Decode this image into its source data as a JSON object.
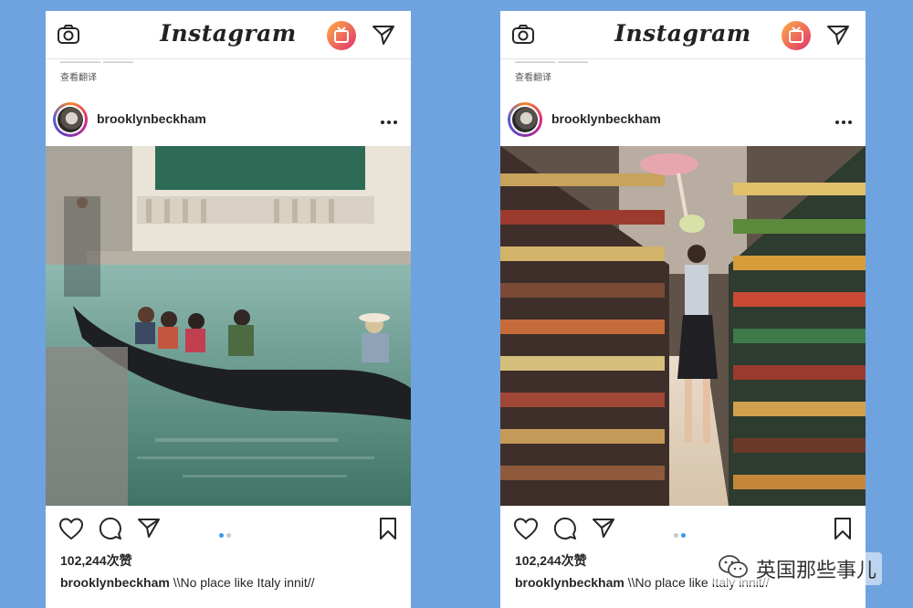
{
  "app": {
    "wordmark": "Instagram"
  },
  "icons": [
    "camera-icon",
    "igtv-icon",
    "send-icon",
    "more-icon",
    "heart-icon",
    "comment-icon",
    "share-icon",
    "bookmark-icon"
  ],
  "colors": {
    "igtv_gradient_start": "#fcaf45",
    "igtv_gradient_end": "#e1306c",
    "carousel_active": "#3897f0",
    "carousel_inactive": "#c7c7c7"
  },
  "posts": [
    {
      "translate_link": "查看翻译",
      "username": "brooklynbeckham",
      "likes": "102,244次赞",
      "caption_user": "brooklynbeckham",
      "caption_text": " \\\\No place like Italy innit//",
      "carousel": {
        "count": 2,
        "active": 1
      }
    },
    {
      "translate_link": "查看翻译",
      "username": "brooklynbeckham",
      "likes": "102,244次赞",
      "caption_user": "brooklynbeckham",
      "caption_text": " \\\\No place like Italy innit//",
      "carousel": {
        "count": 2,
        "active": 2
      }
    }
  ],
  "watermark": {
    "text": "英国那些事儿",
    "icon": "wechat-icon"
  }
}
